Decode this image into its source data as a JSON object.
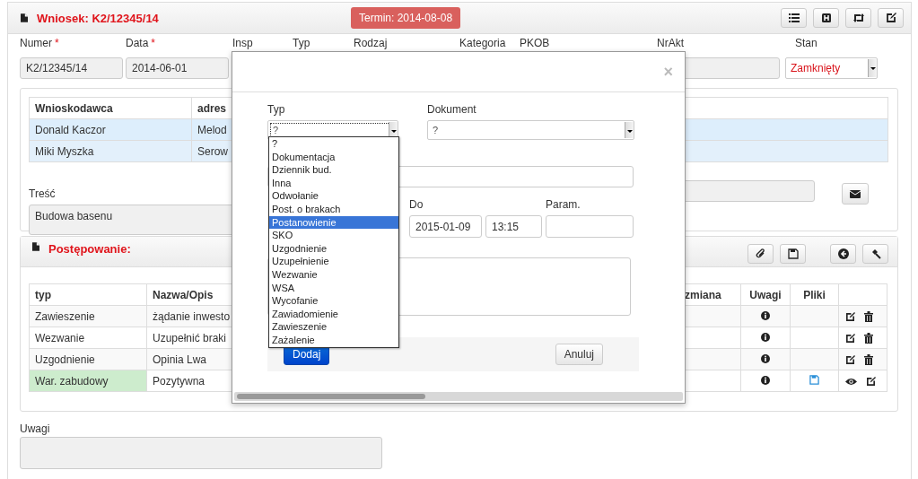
{
  "header": {
    "title": "Wniosek: K2/12345/14",
    "deadline": "Termin: 2014-08-08"
  },
  "field_labels": [
    {
      "label": "Numer",
      "mark": "*"
    },
    {
      "label": "Data",
      "mark": "*"
    },
    {
      "label": "Insp"
    },
    {
      "label": "Typ"
    },
    {
      "label": "Rodzaj"
    },
    {
      "label": "Kategoria"
    },
    {
      "label": "PKOB"
    },
    {
      "label": "NrAkt"
    },
    {
      "label": "Stan"
    }
  ],
  "fields": {
    "number": "K2/12345/14",
    "date": "2014-06-01",
    "status": "Zamknięty"
  },
  "applicants": {
    "columns": [
      "Wnioskodawca",
      "adres"
    ],
    "rows": [
      {
        "name": "Donald Kaczor",
        "address": "Melod"
      },
      {
        "name": "Miki Myszka",
        "address": "Serow"
      }
    ]
  },
  "content_label": "Treść",
  "content": "Budowa basenu",
  "proceedings": {
    "title": "Postępowanie:",
    "columns": [
      "typ",
      "Nazwa/Opis",
      "zmiana",
      "Uwagi",
      "Pliki"
    ],
    "rows": [
      {
        "type": "Zawieszenie",
        "name": "żądanie inwesto",
        "highlighted": false,
        "has_file": false,
        "actions": [
          {
            "kind": "edit"
          },
          {
            "kind": "delete"
          }
        ]
      },
      {
        "type": "Wezwanie",
        "name": "Uzupełnić braki",
        "highlighted": false,
        "has_file": false,
        "actions": [
          {
            "kind": "edit"
          },
          {
            "kind": "delete"
          }
        ]
      },
      {
        "type": "Uzgodnienie",
        "name": "Opinia Lwa",
        "highlighted": false,
        "has_file": false,
        "actions": [
          {
            "kind": "edit"
          },
          {
            "kind": "delete"
          }
        ]
      },
      {
        "type": "War. zabudowy",
        "name": "Pozytywna",
        "highlighted": true,
        "has_file": true,
        "actions": [
          {
            "kind": "view"
          },
          {
            "kind": "edit"
          }
        ]
      }
    ]
  },
  "notes_label": "Uwagi",
  "modal": {
    "close": "×",
    "type_label": "Typ",
    "type_value": "?",
    "type_options": [
      {
        "label": "?",
        "selected": false
      },
      {
        "label": "Dokumentacja",
        "selected": false
      },
      {
        "label": "Dziennik bud.",
        "selected": false
      },
      {
        "label": "Inna",
        "selected": false
      },
      {
        "label": "Odwołanie",
        "selected": false
      },
      {
        "label": "Post. o brakach",
        "selected": false
      },
      {
        "label": "Postanowienie",
        "selected": true
      },
      {
        "label": "SKO",
        "selected": false
      },
      {
        "label": "Uzgodnienie",
        "selected": false
      },
      {
        "label": "Uzupełnienie",
        "selected": false
      },
      {
        "label": "Wezwanie",
        "selected": false
      },
      {
        "label": "WSA",
        "selected": false
      },
      {
        "label": "Wycofanie",
        "selected": false
      },
      {
        "label": "Zawiadomienie",
        "selected": false
      },
      {
        "label": "Zawieszenie",
        "selected": false
      },
      {
        "label": "Zażalenie",
        "selected": false
      }
    ],
    "document_label": "Dokument",
    "document_value": "?",
    "to_label": "Do",
    "date": "2015-01-09",
    "time": "13:15",
    "param_label": "Param.",
    "add_button": "Dodaj",
    "cancel_button": "Anuluj"
  }
}
